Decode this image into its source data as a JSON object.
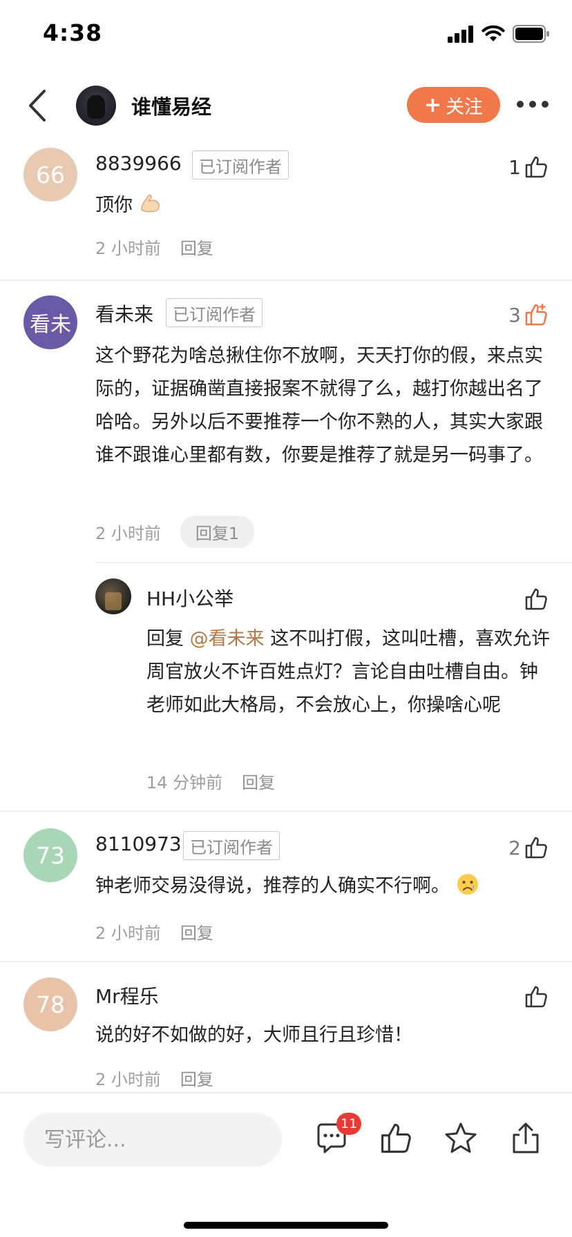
{
  "status_bar": {
    "time": "4:38"
  },
  "header": {
    "author_name": "谁懂易经",
    "follow_label": "关注",
    "follow_plus": "+"
  },
  "comments": [
    {
      "avatar_text": "66",
      "avatar_color": "#e8c9b1",
      "username": "8839966",
      "badge": "已订阅作者",
      "like_count": "1",
      "text": "顶你",
      "emoji": "flexed-biceps",
      "time": "2 小时前",
      "reply_label": "回复"
    },
    {
      "avatar_text": "看未",
      "avatar_color": "#6a5aa6",
      "username": "看未来",
      "badge": "已订阅作者",
      "like_count": "3",
      "liked": true,
      "text": "这个野花为啥总揪住你不放啊，天天打你的假，来点实际的，证据确凿直接报案不就得了么，越打你越出名了哈哈。另外以后不要推荐一个你不熟的人，其实大家跟谁不跟谁心里都有数，你要是推荐了就是另一码事了。",
      "time": "2 小时前",
      "reply_label": "回复1",
      "reply": {
        "username": "HH小公举",
        "reply_prefix": "回复 ",
        "mention": "@看未来",
        "text": " 这不叫打假，这叫吐槽，喜欢允许周官放火不许百姓点灯？言论自由吐槽自由。钟老师如此大格局，不会放心上，你操啥心呢",
        "time": "14 分钟前",
        "reply_label": "回复"
      }
    },
    {
      "avatar_text": "73",
      "avatar_color": "#a9d6b6",
      "username": "8110973",
      "badge": "已订阅作者",
      "like_count": "2",
      "text": "钟老师交易没得说，推荐的人确实不行啊。",
      "emoji": "sad-face",
      "time": "2 小时前",
      "reply_label": "回复"
    },
    {
      "avatar_text": "78",
      "avatar_color": "#e8c3aa",
      "username": "Mr程乐",
      "text": "说的好不如做的好，大师且行且珍惜！",
      "time": "2 小时前",
      "reply_label": "回复"
    }
  ],
  "bottom_bar": {
    "input_placeholder": "写评论...",
    "comment_count": "11"
  },
  "colors": {
    "accent": "#f0784b",
    "badge_red": "#e83a35",
    "mention": "#b57844"
  }
}
